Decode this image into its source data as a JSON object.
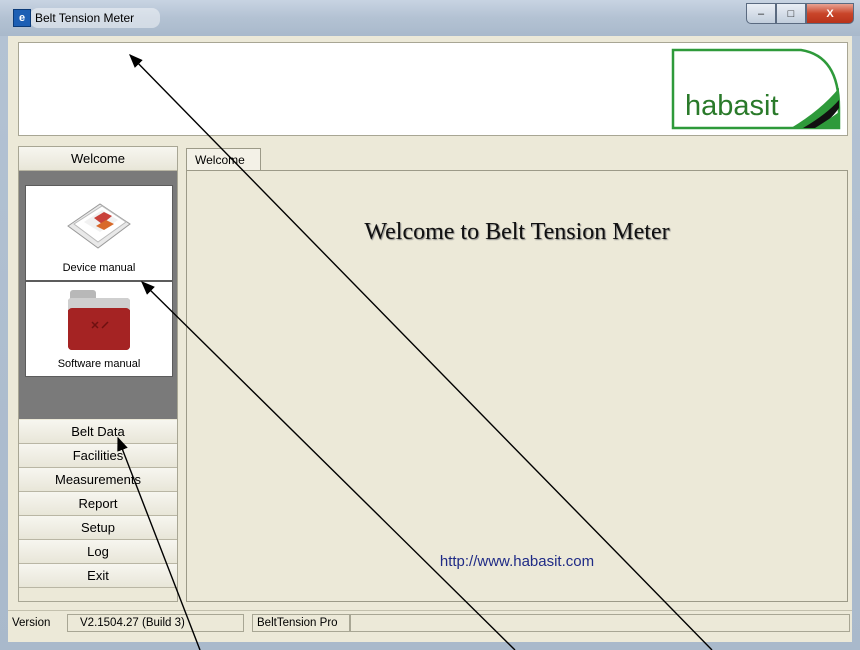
{
  "window": {
    "title": "Belt Tension Meter",
    "minimize": "–",
    "maximize": "□",
    "close": "X"
  },
  "header": {
    "logo_text": "habasit",
    "logo_color": "#2a7a2a"
  },
  "nav": {
    "welcome": "Welcome",
    "documents": [
      {
        "label": "Device manual",
        "icon": "device-manual-icon"
      },
      {
        "label": "Software manual",
        "icon": "software-manual-icon"
      }
    ],
    "items": [
      "Belt Data",
      "Facilities",
      "Measurements",
      "Report",
      "Setup",
      "Log",
      "Exit"
    ]
  },
  "content": {
    "tab": "Welcome",
    "heading": "Welcome to Belt Tension Meter",
    "link": "http://www.habasit.com"
  },
  "status": {
    "label": "Version",
    "version": "V2.1504.27  (Build 3)",
    "product": "BeltTension Pro"
  }
}
